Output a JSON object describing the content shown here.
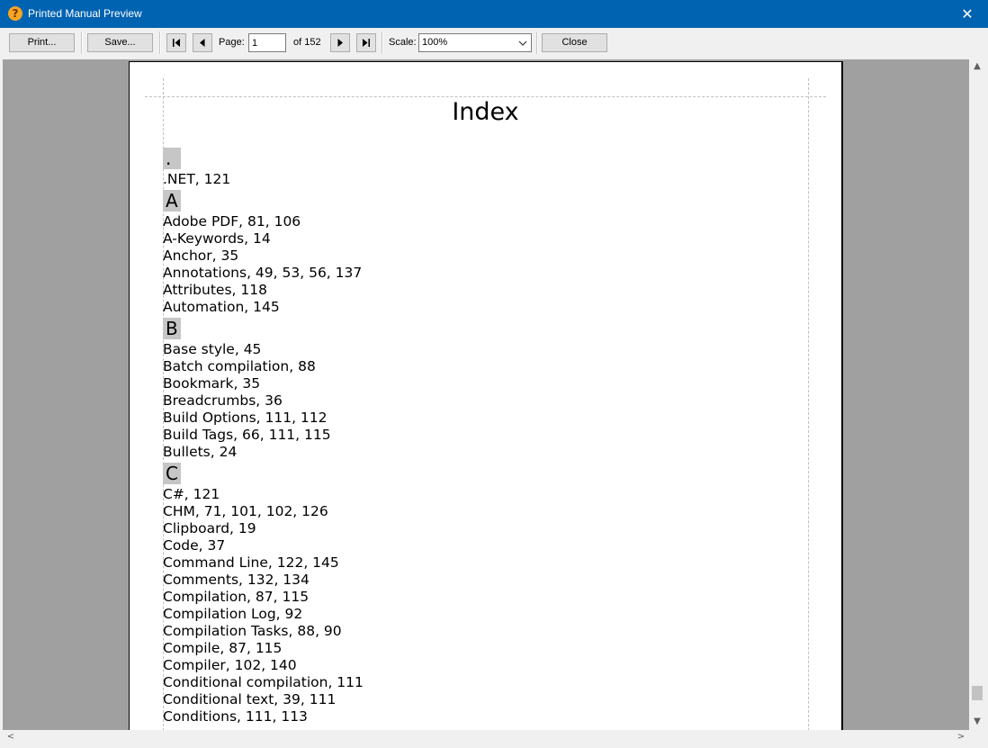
{
  "window": {
    "title": "Printed Manual Preview",
    "close_glyph": "✕",
    "icon": "help-app-icon"
  },
  "toolbar": {
    "print_label": "Print...",
    "save_label": "Save...",
    "page_label": "Page:",
    "page_value": "1",
    "page_of": "of 152",
    "scale_label": "Scale:",
    "scale_value": "100%",
    "close_label": "Close",
    "first_icon": "first-page-icon",
    "prev_icon": "previous-page-icon",
    "next_icon": "next-page-icon",
    "last_icon": "last-page-icon"
  },
  "document": {
    "title": "Index",
    "sections": [
      {
        "letter": ".",
        "entries": [
          ".NET, 121"
        ]
      },
      {
        "letter": "A",
        "entries": [
          "Adobe PDF, 81, 106",
          "A-Keywords, 14",
          "Anchor, 35",
          "Annotations, 49, 53, 56, 137",
          "Attributes, 118",
          "Automation, 145"
        ]
      },
      {
        "letter": "B",
        "entries": [
          "Base style, 45",
          "Batch compilation, 88",
          "Bookmark, 35",
          "Breadcrumbs, 36",
          "Build Options, 111, 112",
          "Build Tags, 66, 111, 115",
          "Bullets, 24"
        ]
      },
      {
        "letter": "C",
        "entries": [
          "C#, 121",
          "CHM, 71, 101, 102, 126",
          "Clipboard, 19",
          "Code, 37",
          "Command Line, 122, 145",
          "Comments, 132, 134",
          "Compilation, 87, 115",
          "Compilation Log, 92",
          "Compilation Tasks, 88, 90",
          "Compile, 87, 115",
          "Compiler, 102, 140",
          "Conditional compilation, 111",
          "Conditional text, 39, 111",
          "Conditions, 111, 113"
        ]
      }
    ]
  },
  "scrollbars": {
    "up_glyph": "▲",
    "down_glyph": "▼",
    "left_glyph": "<",
    "right_glyph": ">"
  }
}
